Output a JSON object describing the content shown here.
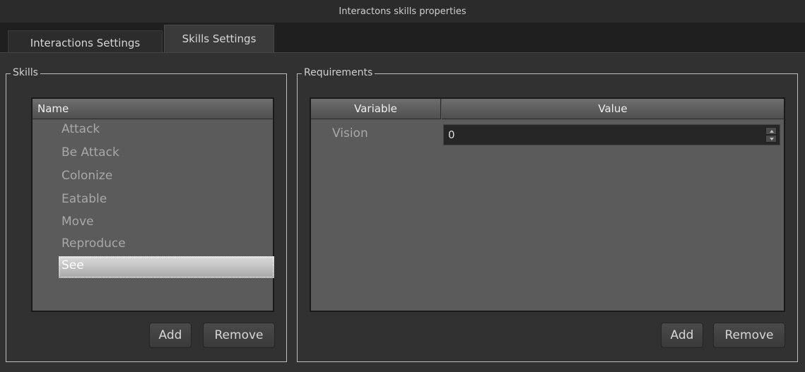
{
  "window": {
    "title": "Interactons skills properties"
  },
  "tabs": [
    {
      "label": "Interactions Settings"
    },
    {
      "label": "Skills Settings"
    }
  ],
  "skills_group": {
    "legend": "Skills",
    "list_header": "Name",
    "items": [
      "Attack",
      "Be Attack",
      "Colonize",
      "Eatable",
      "Move",
      "Reproduce",
      "See"
    ],
    "selected": "See",
    "add_label": "Add",
    "remove_label": "Remove"
  },
  "requirements_group": {
    "legend": "Requirements",
    "columns": [
      "Variable",
      "Value"
    ],
    "rows": [
      {
        "variable": "Vision",
        "value": "0"
      }
    ],
    "add_label": "Add",
    "remove_label": "Remove"
  }
}
